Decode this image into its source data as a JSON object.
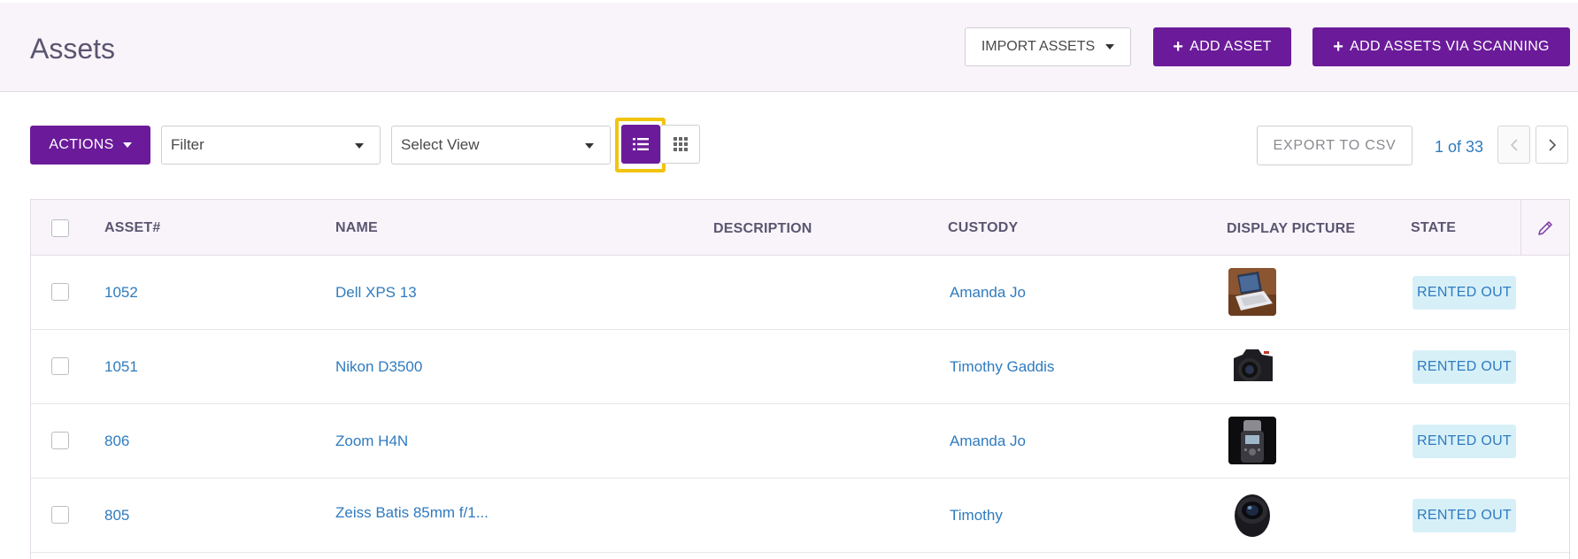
{
  "header": {
    "title": "Assets",
    "import_label": "IMPORT ASSETS",
    "add_label": "ADD ASSET",
    "add_scan_label": "ADD ASSETS VIA SCANNING"
  },
  "toolbar": {
    "actions_label": "ACTIONS",
    "filter_value": "Filter",
    "view_value": "Select View",
    "export_label": "EXPORT TO CSV",
    "pager_text": "1 of 33"
  },
  "table": {
    "columns": [
      "ASSET#",
      "NAME",
      "DESCRIPTION",
      "CUSTODY",
      "DISPLAY PICTURE",
      "STATE"
    ],
    "rows": [
      {
        "asset": "1052",
        "name": "Dell XPS 13",
        "description": "",
        "custody": "Amanda Jo",
        "picture": "laptop",
        "state": "RENTED OUT"
      },
      {
        "asset": "1051",
        "name": "Nikon D3500",
        "description": "",
        "custody": "Timothy Gaddis",
        "picture": "camera",
        "state": "RENTED OUT"
      },
      {
        "asset": "806",
        "name": "Zoom H4N",
        "description": "",
        "custody": "Amanda Jo",
        "picture": "recorder",
        "state": "RENTED OUT"
      },
      {
        "asset": "805",
        "name": "Zeiss Batis 85mm f/1...",
        "description": "",
        "custody": "Timothy",
        "picture": "lens",
        "state": "RENTED OUT"
      }
    ]
  },
  "colors": {
    "primary": "#6b1b9a",
    "link": "#2f7bbf",
    "badge_bg": "#d7f0f8",
    "highlight": "#f1c40f"
  }
}
